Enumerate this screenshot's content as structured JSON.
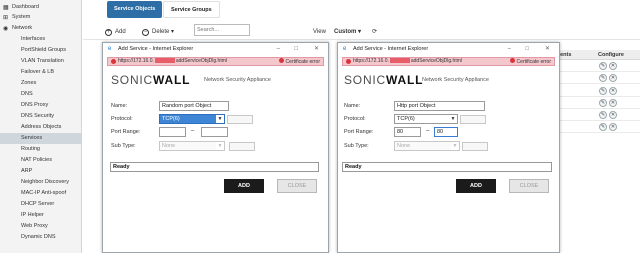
{
  "sidebar": {
    "top_items": [
      {
        "label": "Dashboard",
        "icon": "dashboard-icon"
      },
      {
        "label": "System",
        "icon": "system-icon"
      },
      {
        "label": "Network",
        "icon": "network-icon"
      }
    ],
    "sub_items": [
      {
        "label": "Interfaces"
      },
      {
        "label": "PortShield Groups"
      },
      {
        "label": "VLAN Translation"
      },
      {
        "label": "Failover & LB"
      },
      {
        "label": "Zones"
      },
      {
        "label": "DNS"
      },
      {
        "label": "DNS Proxy"
      },
      {
        "label": "DNS Security"
      },
      {
        "label": "Address Objects"
      },
      {
        "label": "Services",
        "active": true
      },
      {
        "label": "Routing"
      },
      {
        "label": "NAT Policies"
      },
      {
        "label": "ARP"
      },
      {
        "label": "Neighbor Discovery"
      },
      {
        "label": "MAC-IP Anti-spoof"
      },
      {
        "label": "DHCP Server"
      },
      {
        "label": "IP Helper"
      },
      {
        "label": "Web Proxy"
      },
      {
        "label": "Dynamic DNS"
      }
    ]
  },
  "tabs": {
    "service_objects": "Service Objects",
    "service_groups": "Service Groups"
  },
  "toolbar": {
    "add": "Add",
    "delete": "Delete",
    "delete_chevron": "▾",
    "search_placeholder": "Search...",
    "view_label": "View",
    "view_value": "Custom",
    "view_chevron": "▾",
    "refresh_icon": "⟳"
  },
  "table": {
    "header_comments": "Comments",
    "header_configure": "Configure",
    "row_count": 6
  },
  "dialog_left": {
    "title": "Add Service - Internet Explorer",
    "url_prefix": "https://172.16.0.",
    "url_suffix": "addServiceObjDlg.html",
    "cert_error": "Certificate error",
    "logo_main": "SONIC",
    "logo_bold": "WALL",
    "app_name": "Network Security Appliance",
    "name_label": "Name:",
    "name_value": "Random port Object",
    "protocol_label": "Protocol:",
    "protocol_value": "TCP(6)",
    "port_range_label": "Port Range:",
    "port_from": "",
    "port_to": "",
    "sub_type_label": "Sub Type:",
    "sub_type_value": "None",
    "status": "Ready",
    "add_button": "ADD",
    "close_button": "CLOSE"
  },
  "dialog_right": {
    "title": "Add Service - Internet Explorer",
    "url_prefix": "https://172.16.0.",
    "url_suffix": "addServiceObjDlg.html",
    "cert_error": "Certificate error",
    "logo_main": "SONIC",
    "logo_bold": "WALL",
    "app_name": "Network Security Appliance",
    "name_label": "Name:",
    "name_value": "Http port Object",
    "protocol_label": "Protocol:",
    "protocol_value": "TCP(6)",
    "port_range_label": "Port Range:",
    "port_from": "80",
    "port_to": "80",
    "sub_type_label": "Sub Type:",
    "sub_type_value": "None",
    "status": "Ready",
    "add_button": "ADD",
    "close_button": "CLOSE"
  },
  "window_controls": {
    "minimize": "–",
    "maximize": "□",
    "close": "✕"
  },
  "colors": {
    "primary_tab": "#2e6ea6",
    "active_sidebar": "#cfd6dc",
    "cert_error_bar": "#f4c7cd",
    "selected_option": "#3e85d6",
    "add_button": "#1b1b1b"
  }
}
